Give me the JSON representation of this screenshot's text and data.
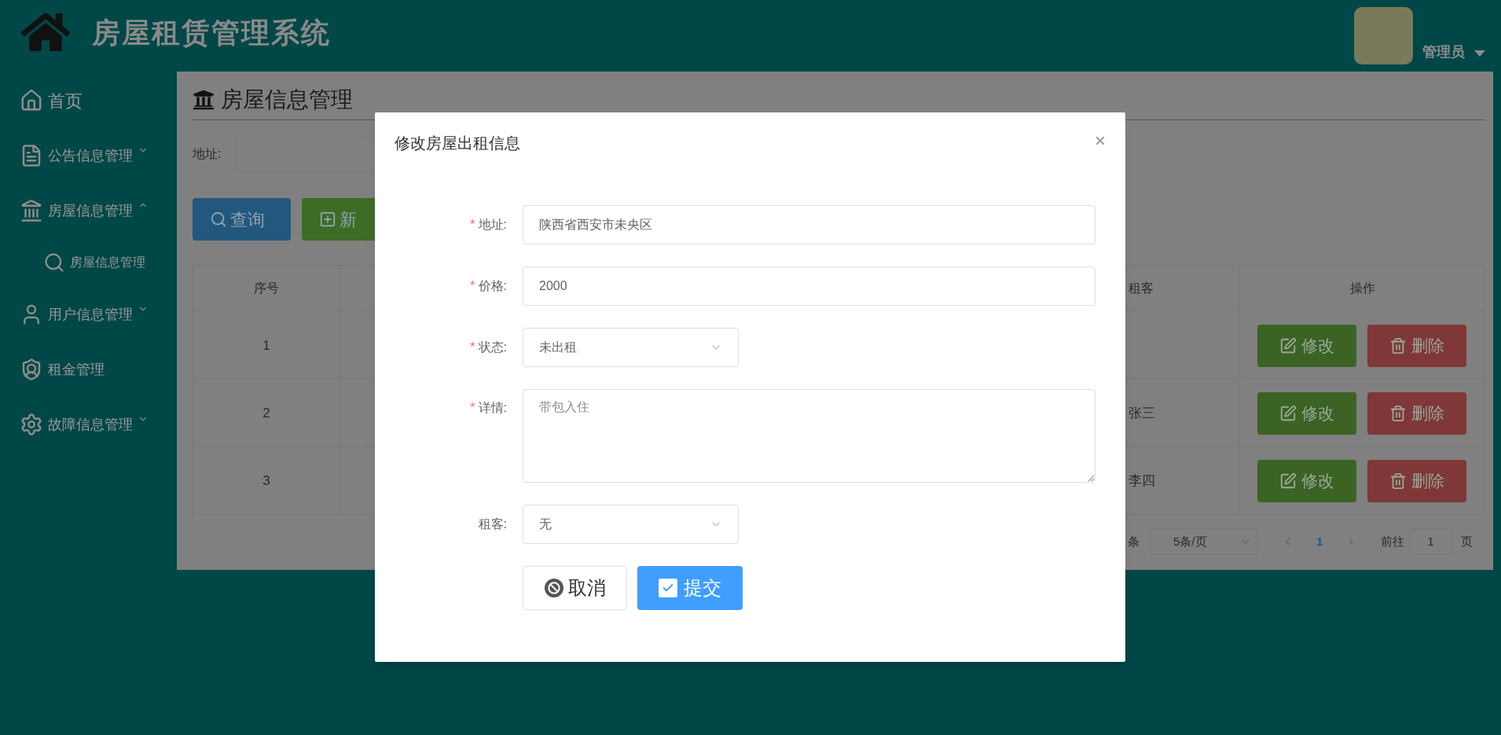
{
  "header": {
    "title": "房屋租赁管理系统",
    "user": "管理员"
  },
  "sidebar": {
    "items": [
      {
        "label": "首页",
        "kind": "link"
      },
      {
        "label": "公告信息管理",
        "kind": "submenu",
        "expanded": false
      },
      {
        "label": "房屋信息管理",
        "kind": "submenu",
        "expanded": true,
        "children": [
          {
            "label": "房屋信息管理"
          }
        ]
      },
      {
        "label": "用户信息管理",
        "kind": "submenu",
        "expanded": false
      },
      {
        "label": "租金管理",
        "kind": "link"
      },
      {
        "label": "故障信息管理",
        "kind": "submenu",
        "expanded": false
      }
    ]
  },
  "page": {
    "title": "房屋信息管理",
    "search": {
      "label": "地址:"
    },
    "buttons": [
      {
        "label": "查询",
        "kind": "query"
      },
      {
        "label": "新",
        "kind": "add"
      }
    ]
  },
  "table": {
    "columns": [
      "序号",
      "租客",
      "操作"
    ],
    "rows": [
      {
        "index": "1",
        "actions": [
          "修改",
          "删除"
        ]
      },
      {
        "index": "2",
        "tenant": "张三",
        "actions": [
          "修改",
          "删除"
        ]
      },
      {
        "index": "3",
        "tenant": "李四",
        "actions": [
          "修改",
          "删除"
        ]
      }
    ]
  },
  "pagination": {
    "total_tail": "条",
    "page_size": "5条/页",
    "pages": [
      {
        "label": "1",
        "selected": true
      }
    ],
    "goto_label": "前往",
    "goto_value": "1",
    "goto_suffix": "页"
  },
  "dialog": {
    "title": "修改房屋出租信息",
    "close": "×",
    "required_mark": "*",
    "fields": [
      {
        "label": "地址:",
        "required": true,
        "kind": "input",
        "value": "陕西省西安市未央区"
      },
      {
        "label": "价格:",
        "required": true,
        "kind": "input",
        "value": "2000"
      },
      {
        "label": "状态:",
        "required": true,
        "kind": "select",
        "value": "未出租"
      },
      {
        "label": "详情:",
        "required": true,
        "kind": "textarea",
        "placeholder": "带包入住"
      },
      {
        "label": "租客:",
        "required": false,
        "kind": "select",
        "value": "无"
      }
    ],
    "buttons": [
      {
        "label": "取消",
        "kind": "cancel"
      },
      {
        "label": "提交",
        "kind": "submit"
      }
    ]
  }
}
